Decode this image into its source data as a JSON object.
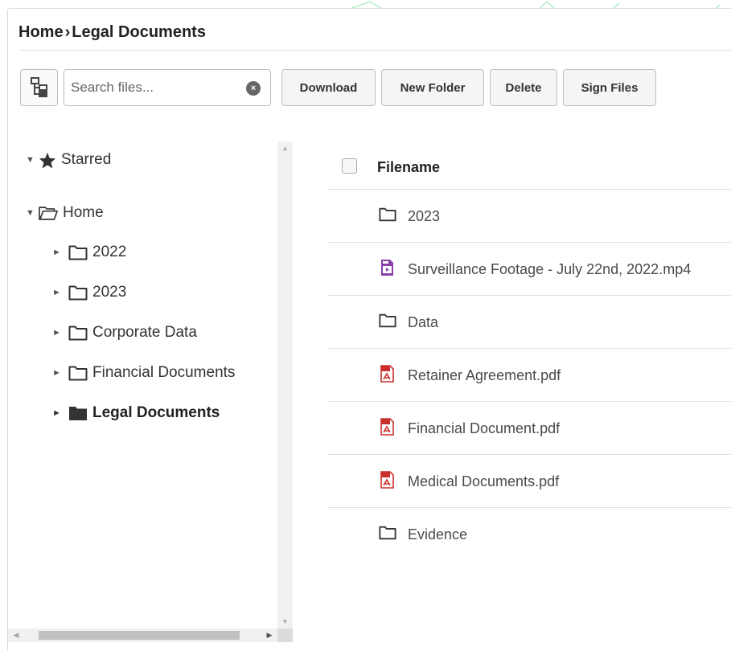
{
  "breadcrumb": {
    "root": "Home",
    "separator": "›",
    "current": "Legal Documents"
  },
  "toolbar": {
    "tree_toggle_icon": "tree-view-icon",
    "search_placeholder": "Search files...",
    "clear_icon": "clear-icon",
    "buttons": {
      "download": "Download",
      "new_folder": "New Folder",
      "delete": "Delete",
      "sign_files": "Sign Files"
    }
  },
  "tree": {
    "starred": {
      "label": "Starred",
      "icon": "star-icon",
      "expanded": true
    },
    "home": {
      "label": "Home",
      "icon": "folder-open-icon",
      "expanded": true
    },
    "children": [
      {
        "label": "2022",
        "icon": "folder-icon"
      },
      {
        "label": "2023",
        "icon": "folder-icon"
      },
      {
        "label": "Corporate Data",
        "icon": "folder-icon"
      },
      {
        "label": "Financial Documents",
        "icon": "folder-icon"
      },
      {
        "label": "Legal Documents",
        "icon": "folder-filled-icon",
        "selected": true
      }
    ]
  },
  "files": {
    "header": "Filename",
    "rows": [
      {
        "name": "2023",
        "type": "folder"
      },
      {
        "name": "Surveillance Footage - July 22nd, 2022.mp4",
        "type": "video"
      },
      {
        "name": "Data",
        "type": "folder"
      },
      {
        "name": "Retainer Agreement.pdf",
        "type": "pdf"
      },
      {
        "name": "Financial Document.pdf",
        "type": "pdf"
      },
      {
        "name": "Medical Documents.pdf",
        "type": "pdf"
      },
      {
        "name": "Evidence",
        "type": "folder"
      }
    ]
  },
  "colors": {
    "pdf": "#c9302c",
    "video": "#8a3ea8",
    "folder": "#333333",
    "accent_lines": "#7fd8a0"
  }
}
